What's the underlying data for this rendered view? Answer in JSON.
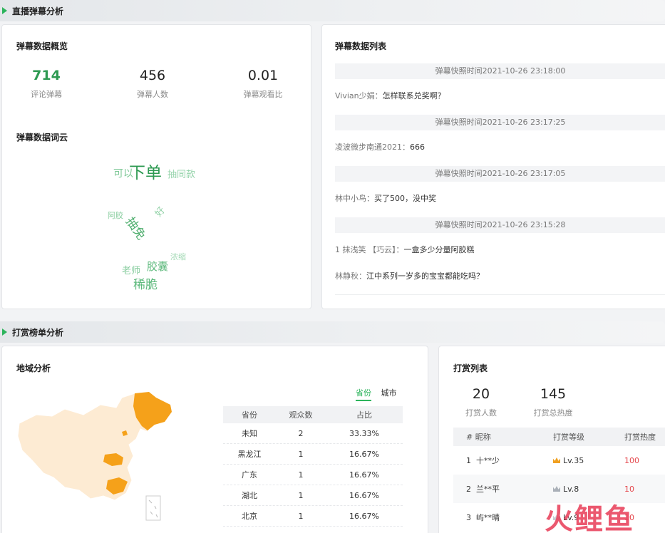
{
  "sections": {
    "danmu": "直播弹幕分析",
    "reward": "打赏榜单分析"
  },
  "overview": {
    "title": "弹幕数据概览",
    "stats": [
      {
        "value": "714",
        "label": "评论弹幕"
      },
      {
        "value": "456",
        "label": "弹幕人数"
      },
      {
        "value": "0.01",
        "label": "弹幕观看比"
      }
    ]
  },
  "wordcloud": {
    "title": "弹幕数据词云",
    "words": [
      "可以",
      "下单",
      "抽同款",
      "阿胶",
      "抽免",
      "好",
      "老师",
      "胶囊",
      "浓缩",
      "稀脆"
    ]
  },
  "danmu_list": {
    "title": "弹幕数据列表",
    "groups": [
      {
        "snapshot": "弹幕快照时间2021-10-26 23:18:00",
        "messages": [
          {
            "user": "Vivian少娟：",
            "text": "怎样联系兑奖啊？"
          }
        ]
      },
      {
        "snapshot": "弹幕快照时间2021-10-26 23:17:25",
        "messages": [
          {
            "user": "凌波微步南通2021：",
            "text": "666"
          }
        ]
      },
      {
        "snapshot": "弹幕快照时间2021-10-26 23:17:05",
        "messages": [
          {
            "user": "林中小鸟：",
            "text": "买了500，没中奖"
          }
        ]
      },
      {
        "snapshot": "弹幕快照时间2021-10-26 23:15:28",
        "messages": [
          {
            "user": "1 抹浅笑 【巧云】：",
            "text": "一盒多少分量阿胶糕"
          },
          {
            "user": "林静秋：",
            "text": "江中系列一岁多的宝宝都能吃吗？"
          }
        ]
      }
    ]
  },
  "region": {
    "title": "地域分析",
    "tabs": [
      "省份",
      "城市"
    ],
    "active_tab": "省份",
    "columns": [
      "省份",
      "观众数",
      "占比"
    ],
    "rows": [
      [
        "未知",
        "2",
        "33.33%"
      ],
      [
        "黑龙江",
        "1",
        "16.67%"
      ],
      [
        "广东",
        "1",
        "16.67%"
      ],
      [
        "湖北",
        "1",
        "16.67%"
      ],
      [
        "北京",
        "1",
        "16.67%"
      ]
    ],
    "map_colors": {
      "base": "#fdebd3",
      "highlight": "#f5a11a"
    }
  },
  "reward": {
    "title": "打赏列表",
    "stats": [
      {
        "value": "20",
        "label": "打赏人数"
      },
      {
        "value": "145",
        "label": "打赏总热度"
      }
    ],
    "columns": [
      "# 昵称",
      "打赏等级",
      "打赏热度"
    ],
    "rows": [
      {
        "rank": "1",
        "name": "十**少",
        "level": "Lv.35",
        "heat": "100",
        "crown": "gold"
      },
      {
        "rank": "2",
        "name": "兰**平",
        "level": "Lv.8",
        "heat": "10",
        "crown": "silver"
      },
      {
        "rank": "3",
        "name": "屿**晴",
        "level": "Lv.9",
        "heat": "10",
        "crown": "grey"
      }
    ]
  },
  "watermark": "火鲤鱼",
  "colors": {
    "accent": "#2db45c",
    "heat": "#e5484d",
    "watermark": "#e94660"
  }
}
